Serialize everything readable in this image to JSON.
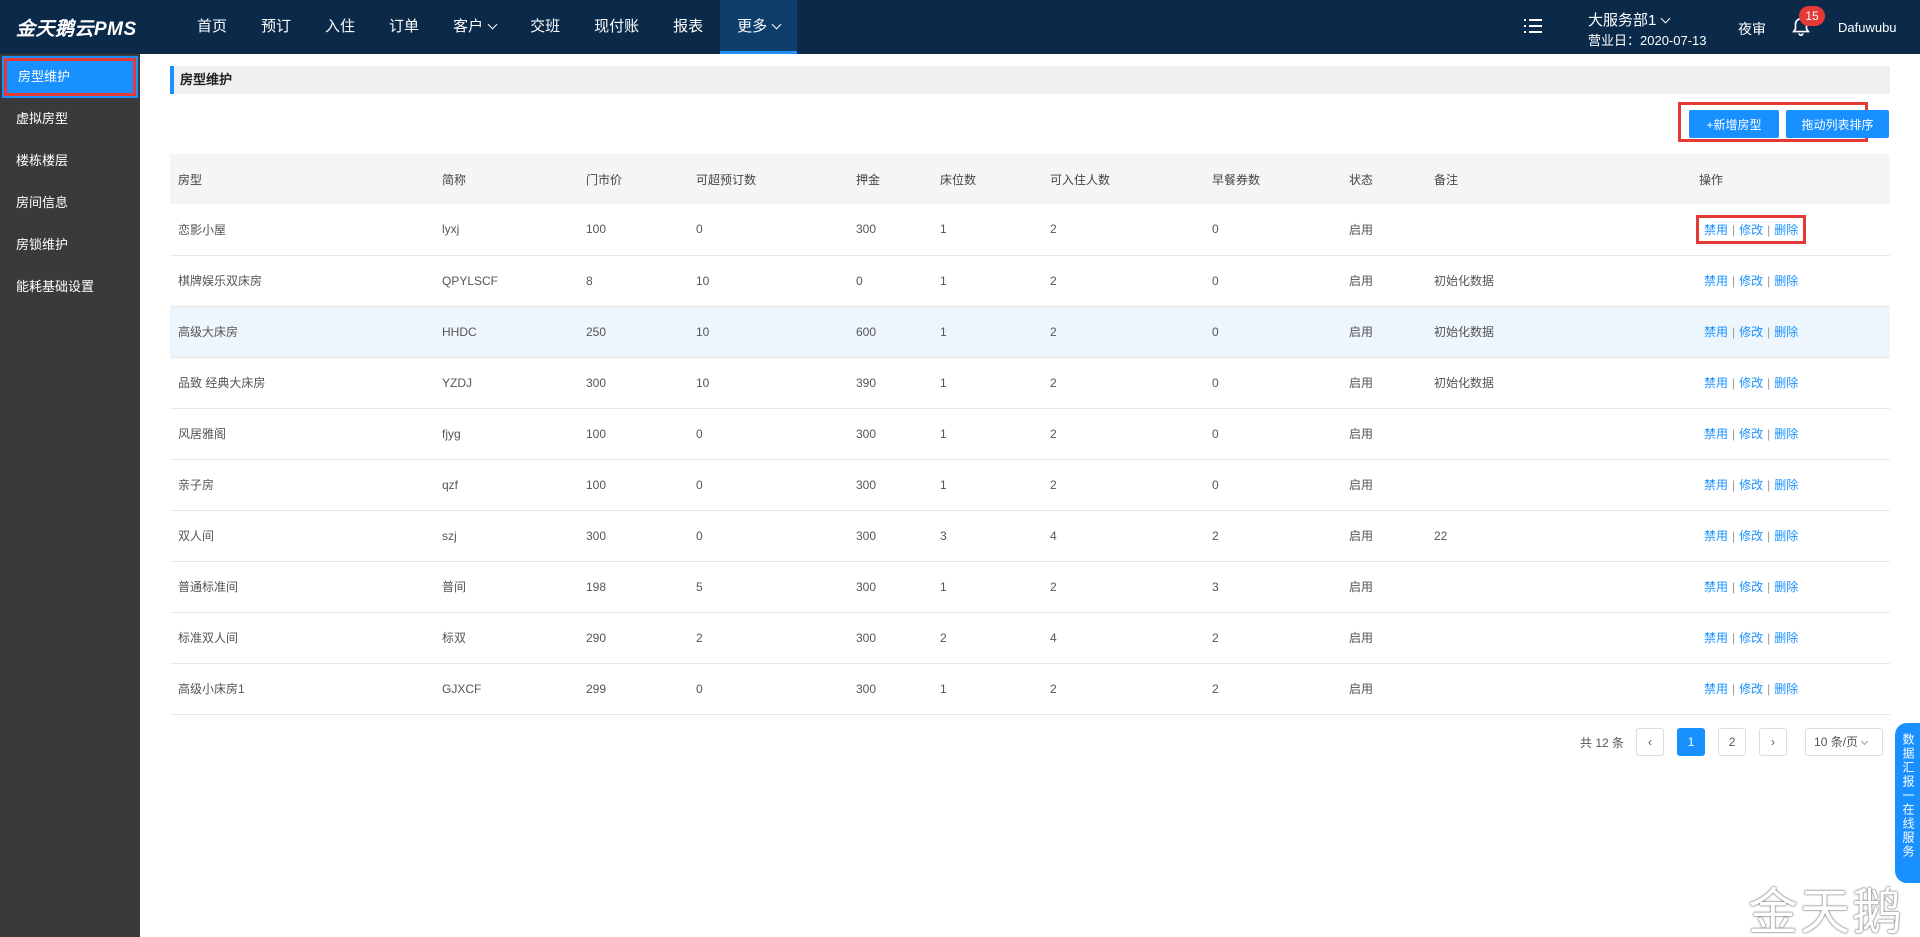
{
  "app": {
    "logo": "金天鹅云PMS"
  },
  "nav": [
    {
      "label": "首页"
    },
    {
      "label": "预订"
    },
    {
      "label": "入住"
    },
    {
      "label": "订单"
    },
    {
      "label": "客户",
      "dropdown": true
    },
    {
      "label": "交班"
    },
    {
      "label": "现付账"
    },
    {
      "label": "报表"
    },
    {
      "label": "更多",
      "dropdown": true,
      "active": true
    }
  ],
  "header": {
    "department": "大服务部1",
    "business_date": "营业日：2020-07-13",
    "night_audit": "夜审",
    "notification_count": "15",
    "user": "Dafuwubu"
  },
  "sidebar": {
    "items": [
      {
        "label": "房型维护",
        "active": true
      },
      {
        "label": "虚拟房型"
      },
      {
        "label": "楼栋楼层"
      },
      {
        "label": "房间信息"
      },
      {
        "label": "房锁维护"
      },
      {
        "label": "能耗基础设置"
      }
    ]
  },
  "page": {
    "title": "房型维护",
    "add_label": "+新增房型",
    "sort_label": "拖动列表排序"
  },
  "table": {
    "columns": [
      "房型",
      "简称",
      "门市价",
      "可超预订数",
      "押金",
      "床位数",
      "可入住人数",
      "早餐券数",
      "状态",
      "备注",
      "操作"
    ],
    "rows": [
      [
        "恋影小屋",
        "lyxj",
        "100",
        "0",
        "300",
        "1",
        "2",
        "0",
        "启用",
        ""
      ],
      [
        "棋牌娱乐双床房",
        "QPYLSCF",
        "8",
        "10",
        "0",
        "1",
        "2",
        "0",
        "启用",
        "初始化数据"
      ],
      [
        "高级大床房",
        "HHDC",
        "250",
        "10",
        "600",
        "1",
        "2",
        "0",
        "启用",
        "初始化数据"
      ],
      [
        "品致 经典大床房",
        "YZDJ",
        "300",
        "10",
        "390",
        "1",
        "2",
        "0",
        "启用",
        "初始化数据"
      ],
      [
        "风居雅阁",
        "fjyg",
        "100",
        "0",
        "300",
        "1",
        "2",
        "0",
        "启用",
        ""
      ],
      [
        "亲子房",
        "qzf",
        "100",
        "0",
        "300",
        "1",
        "2",
        "0",
        "启用",
        ""
      ],
      [
        "双人间",
        "szj",
        "300",
        "0",
        "300",
        "3",
        "4",
        "2",
        "启用",
        "22"
      ],
      [
        "普通标准间",
        "普间",
        "198",
        "5",
        "300",
        "1",
        "2",
        "3",
        "启用",
        ""
      ],
      [
        "标准双人间",
        "标双",
        "290",
        "2",
        "300",
        "2",
        "4",
        "2",
        "启用",
        ""
      ],
      [
        "高级小床房1",
        "GJXCF",
        "299",
        "0",
        "300",
        "1",
        "2",
        "2",
        "启用",
        ""
      ]
    ],
    "ops": {
      "disable": "禁用",
      "edit": "修改",
      "delete": "删除",
      "separator": "|"
    }
  },
  "pagination": {
    "total": "共 12 条",
    "prev": "‹",
    "next": "›",
    "pages": [
      "1",
      "2"
    ],
    "current": "1",
    "page_size": "10 条/页"
  },
  "service_tab": "数据汇报一在线服务",
  "watermark": "金天鹅",
  "colors": {
    "topbar": "#0b2a4a",
    "accent": "#1890ff",
    "sidebar": "#3a3a3a",
    "highlight": "#e53935"
  }
}
